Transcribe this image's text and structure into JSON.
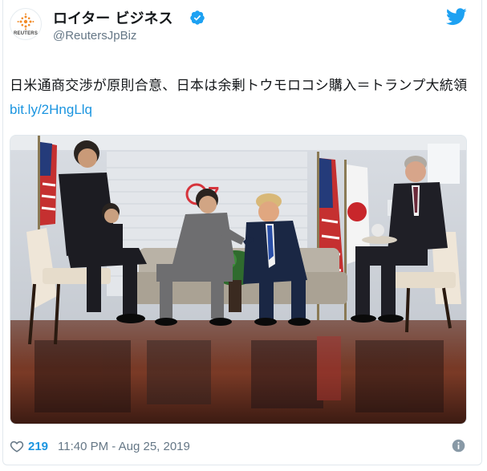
{
  "tweet": {
    "display_name": "ロイター ビジネス",
    "screen_name": "@ReutersJpBiz",
    "avatar_text": "REUTERS",
    "text": "日米通商交渉が原則合意、日本は余剰トウモロコシ購入＝トランプ大統領 ",
    "link": "bit.ly/2HngLlq",
    "likes": "219",
    "timestamp": "11:40 PM - Aug 25, 2019",
    "photo_logo_text": "C7"
  },
  "colors": {
    "link": "#1b95e0",
    "verified": "#1da1f2",
    "secondary_text": "#657786",
    "avatar_orange": "#f28c28"
  },
  "icons": {
    "brand": "twitter-bird-icon",
    "verified": "verified-badge-icon",
    "like": "heart-icon",
    "info": "info-icon"
  }
}
